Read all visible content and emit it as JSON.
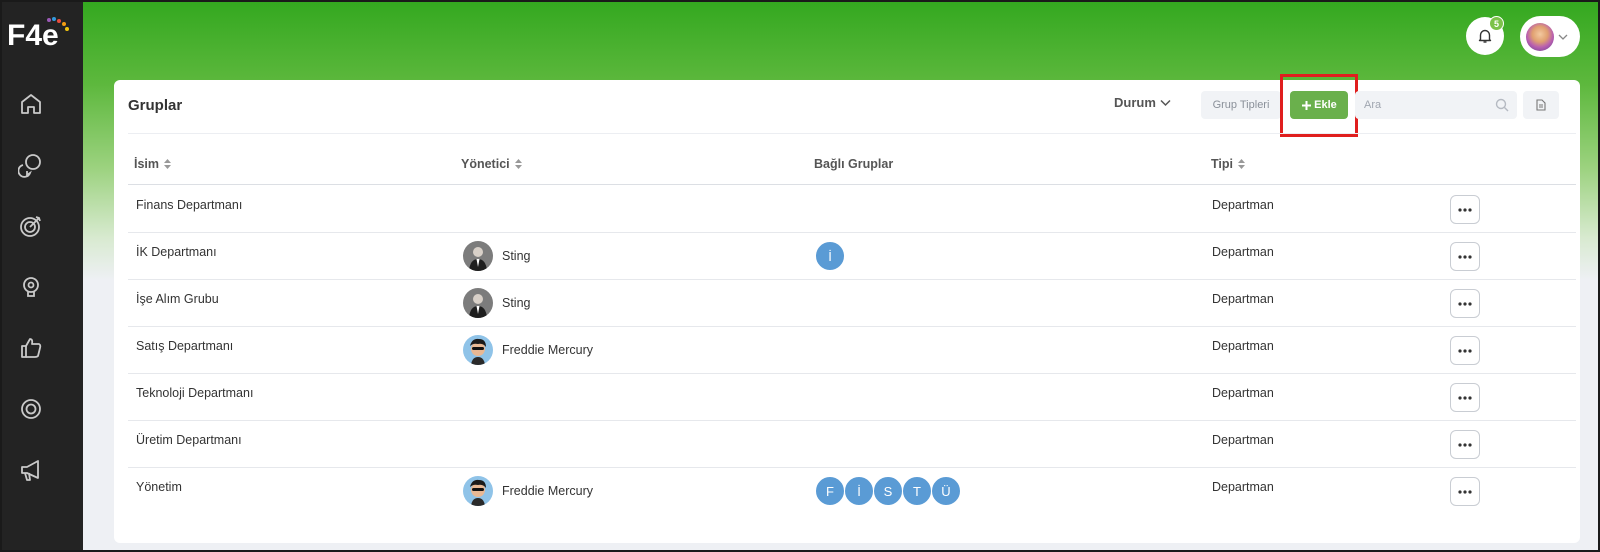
{
  "header": {
    "notification_count": "5"
  },
  "colors": {
    "brand_green": "#33a81f",
    "add_button": "#6ab04c",
    "group_chip": "#5a9bd5",
    "sidebar": "#232323",
    "highlight": "#e01e1e"
  },
  "sidebar": {
    "logo_text": "F4e",
    "items": [
      {
        "icon": "home-icon"
      },
      {
        "icon": "chat-bubbles-icon"
      },
      {
        "icon": "target-icon"
      },
      {
        "icon": "lightbulb-icon"
      },
      {
        "icon": "thumbs-up-icon"
      },
      {
        "icon": "settings-icon"
      },
      {
        "icon": "megaphone-icon"
      }
    ]
  },
  "toolbar": {
    "title": "Gruplar",
    "status_filter": "Durum",
    "group_types_label": "Grup Tipleri",
    "add_label": "Ekle",
    "search_placeholder": "Ara"
  },
  "table": {
    "columns": {
      "name": "İsim",
      "manager": "Yönetici",
      "linked_groups": "Bağlı Gruplar",
      "type": "Tipi"
    },
    "rows": [
      {
        "name": "Finans Departmanı",
        "manager": "",
        "linked_groups": [],
        "type": "Departman"
      },
      {
        "name": "İK Departmanı",
        "manager": "Sting",
        "linked_groups": [
          "İ"
        ],
        "type": "Departman"
      },
      {
        "name": "İşe Alım Grubu",
        "manager": "Sting",
        "linked_groups": [],
        "type": "Departman"
      },
      {
        "name": "Satış Departmanı",
        "manager": "Freddie Mercury",
        "linked_groups": [],
        "type": "Departman"
      },
      {
        "name": "Teknoloji Departmanı",
        "manager": "",
        "linked_groups": [],
        "type": "Departman"
      },
      {
        "name": "Üretim Departmanı",
        "manager": "",
        "linked_groups": [],
        "type": "Departman"
      },
      {
        "name": "Yönetim",
        "manager": "Freddie Mercury",
        "linked_groups": [
          "F",
          "İ",
          "S",
          "T",
          "Ü"
        ],
        "type": "Departman"
      }
    ]
  }
}
